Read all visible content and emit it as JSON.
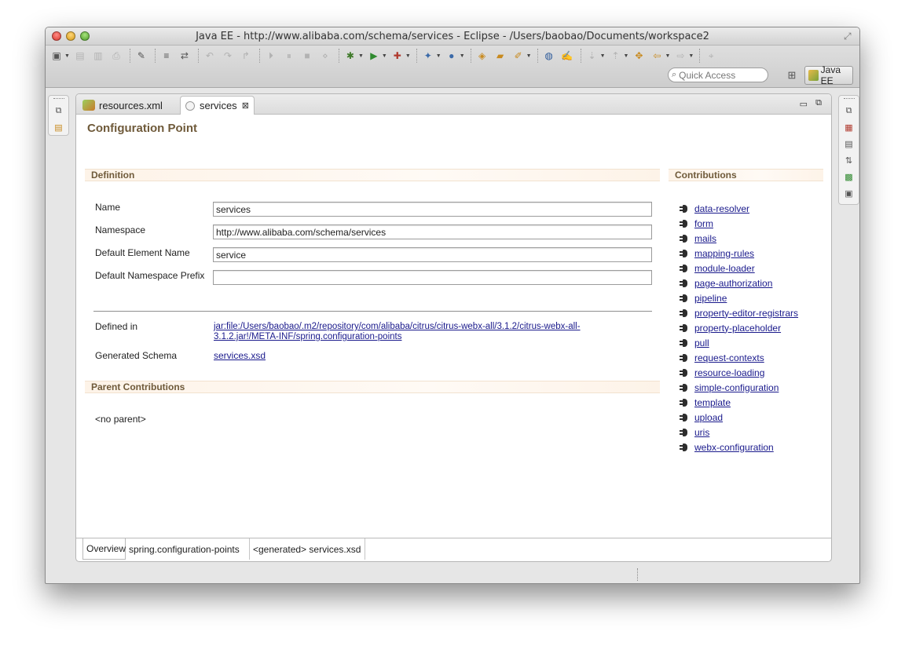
{
  "window": {
    "title": "Java EE - http://www.alibaba.com/schema/services - Eclipse - /Users/baobao/Documents/workspace2"
  },
  "toolbar": {
    "quick_access_placeholder": "Quick Access",
    "perspective_label": "Java EE"
  },
  "editor": {
    "tabs": [
      {
        "label": "resources.xml",
        "active": false
      },
      {
        "label": "services",
        "active": true
      }
    ],
    "form_title": "Configuration Point",
    "definition": {
      "header": "Definition",
      "name_label": "Name",
      "name_value": "services",
      "namespace_label": "Namespace",
      "namespace_value": "http://www.alibaba.com/schema/services",
      "default_element_label": "Default Element Name",
      "default_element_value": "service",
      "default_prefix_label": "Default Namespace Prefix",
      "default_prefix_value": "",
      "defined_in_label": "Defined in",
      "defined_in_value": "jar:file:/Users/baobao/.m2/repository/com/alibaba/citrus/citrus-webx-all/3.1.2/citrus-webx-all-3.1.2.jar!/META-INF/spring.configuration-points",
      "generated_schema_label": "Generated Schema",
      "generated_schema_value": "services.xsd"
    },
    "parent_contributions": {
      "header": "Parent Contributions",
      "value": "<no parent>"
    },
    "contributions": {
      "header": "Contributions",
      "items": [
        "data-resolver",
        "form",
        "mails",
        "mapping-rules",
        "module-loader",
        "page-authorization",
        "pipeline",
        "property-editor-registrars",
        "property-placeholder",
        "pull",
        "request-contexts",
        "resource-loading",
        "simple-configuration",
        "template",
        "upload",
        "uris",
        "webx-configuration"
      ]
    },
    "bottom_tabs": [
      {
        "label": "Overview",
        "active": true
      },
      {
        "label": "spring.configuration-points",
        "active": false
      },
      {
        "label": "<generated> services.xsd",
        "active": false
      }
    ]
  }
}
